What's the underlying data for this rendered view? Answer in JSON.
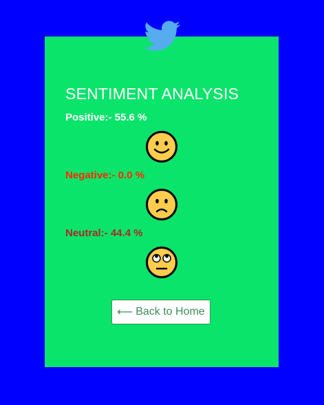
{
  "page": {
    "title": "SENTIMENT ANALYSIS"
  },
  "results": [
    {
      "label": "Positive:- 55.6 %",
      "emoji": "smiling-face-icon"
    },
    {
      "label": "Negative:- 0.0 %",
      "emoji": "frowning-face-icon"
    },
    {
      "label": "Neutral:- 44.4 %",
      "emoji": "eye-roll-face-icon"
    }
  ],
  "back_button": {
    "arrow": "⟵",
    "label": "Back to Home"
  },
  "colors": {
    "background": "#0000ff",
    "card": "#0ae46a",
    "positive": "#ffffff",
    "negative": "#ff2a00",
    "neutral": "#a52a2a",
    "twitter_blue": "#55acee"
  },
  "icons": {
    "logo": "twitter-bird-icon"
  }
}
